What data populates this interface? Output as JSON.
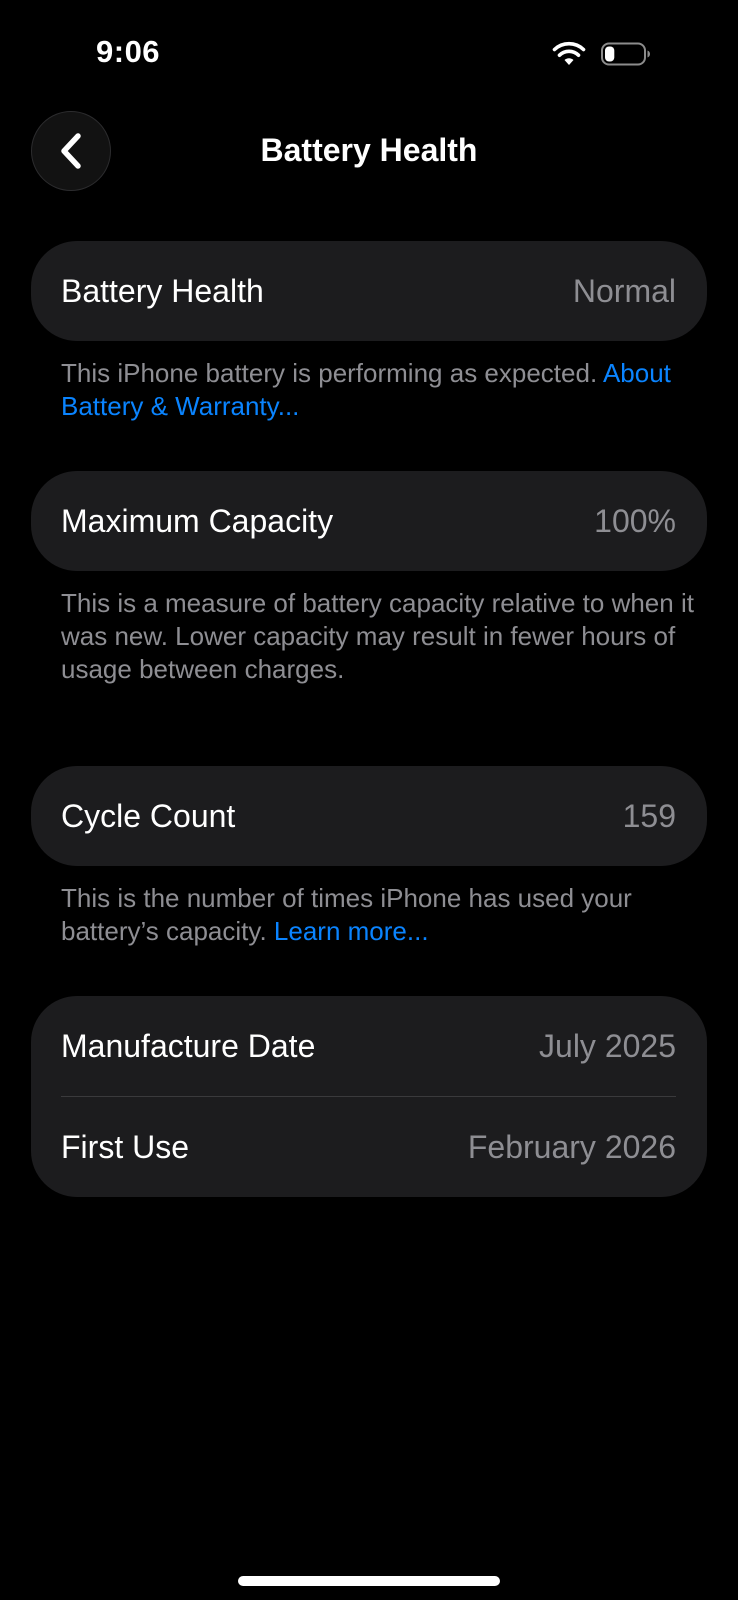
{
  "status_bar": {
    "time": "9:06",
    "wifi_icon": "wifi-icon",
    "battery_icon": "battery-icon",
    "battery_level": 0.25
  },
  "nav": {
    "back_icon": "chevron-left-icon",
    "title": "Battery Health"
  },
  "sections": {
    "battery_health": {
      "label": "Battery Health",
      "value": "Normal",
      "footnote_text": "This iPhone battery is performing as expected. ",
      "footnote_link": "About Battery & Warranty..."
    },
    "maximum_capacity": {
      "label": "Maximum Capacity",
      "value": "100%",
      "footnote_text": "This is a measure of battery capacity relative to when it was new. Lower capacity may result in fewer hours of usage between charges."
    },
    "cycle_count": {
      "label": "Cycle Count",
      "value": "159",
      "footnote_text": "This is the number of times iPhone has used your battery’s capacity. ",
      "footnote_link": "Learn more..."
    },
    "dates": {
      "manufacture_label": "Manufacture Date",
      "manufacture_value": "July 2025",
      "first_use_label": "First Use",
      "first_use_value": "February 2026"
    }
  },
  "colors": {
    "background": "#000000",
    "card": "#1c1c1e",
    "secondary_text": "#8e8e93",
    "link": "#0a84ff"
  }
}
